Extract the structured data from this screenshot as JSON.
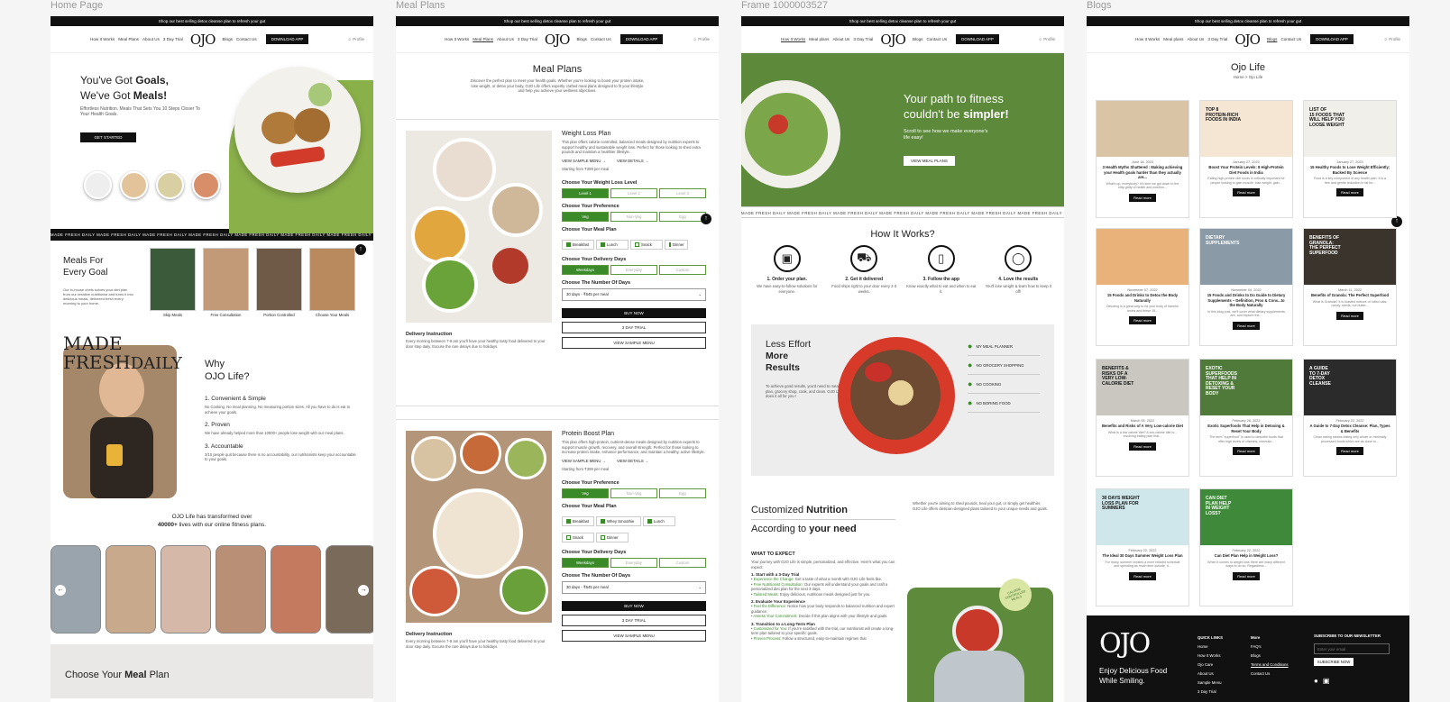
{
  "frames": {
    "home": "Home Page",
    "meal": "Meal Plans",
    "frame": "Frame 1000003527",
    "blogs": "Blogs"
  },
  "announce": "Shop our best selling detox cleanse plan to refresh your gut",
  "nav": {
    "how": "How It Works",
    "meal": "Meal Plans",
    "meal2": "Meal plans",
    "about": "About Us",
    "trial": "3 Day Trial",
    "logo": "OJO",
    "blogs": "Blogs",
    "contact": "Contact Us",
    "download": "DOWNLOAD APP",
    "profile": "Profile"
  },
  "marquee": "MADE FRESH DAILY    MADE FRESH DAILY    MADE FRESH DAILY    MADE FRESH DAILY    MADE FRESH DAILY    MADE FRESH DAILY    MADE FRESH DAILY    MADE FRESH DAILY",
  "home": {
    "hero1": "You've Got ",
    "hero1b": "Goals,",
    "hero2": "We've Got ",
    "hero2b": "Meals!",
    "sub": "Effortless Nutrition. Meals That Sets You 10 Steps Closer To Your Health Goals.",
    "cta": "GET STARTED",
    "meals_title": "Meals For Every Goal",
    "meals_desc": "Our in-house chefs solves your diet plan from our creative nutritionist and turns it into delicious meals, delivered fresh every morning to your home.",
    "tiles": [
      "Skip Meals",
      "Free Consultation",
      "Portion Controlled",
      "Choose Your Meals"
    ],
    "made": "MADE",
    "fresh": "FRESH",
    "daily": "DAILY",
    "why": "Why",
    "why2": "OJO Life?",
    "p1": "1. Convenient & Simple",
    "p1d": "No Cooking. No meal planning. No measuring portion sizes. All you have to do is eat to achieve your goals.",
    "p2": "2. Proven",
    "p2d": "We have already helped more than 10000+ people lose weight with our meal plans.",
    "p3": "3. Accountable",
    "p3d": "3/10 people quit because there is no accountability, our nutritionists keep your accountable to your goals.",
    "transform": "OJO Life has transformed over",
    "transform2": "40000+",
    "transform3": " lives with our online fitness plans.",
    "choose": "Choose Your ",
    "choose_b": "Meal",
    " choose_c": " Plan"
  },
  "meal": {
    "title": "Meal Plans",
    "intro": "Discover the perfect plan to meet your health goals. Whether you're looking to boost your protein intake, lose weight, or detox your body, OJO Life offers expertly crafted meal plans designed to fit your lifestyle and help you achieve your wellness objectives.",
    "wl": "Weight Loss Plan",
    "wl_desc": "This plan offers calorie controlled, balanced meals designed by nutrition experts to support healthy and sustainable weight loss. Perfect for those looking to shed extra pounds and maintain a healthier lifestyle.",
    "sample": "VIEW SAMPLE MENU",
    "details": "VIEW DETAILS",
    "start1": "Starting from ₹399 per meal",
    "lvl_h": "Choose Your Weight Loss Level",
    "lvls": [
      "Level 1",
      "Level 2",
      "Level 3"
    ],
    "pref_h": "Choose Your Preference",
    "prefs": [
      "Veg",
      "Non-Veg",
      "Egg"
    ],
    "mealh": "Choose Your Meal Plan",
    "meals": [
      "Breakfast",
      "Lunch",
      "Snack",
      "Dinner"
    ],
    "days_h": "Choose Your Delivery Days",
    "days": [
      "Weekdays",
      "Everyday",
      "Custom"
    ],
    "num_h": "Choose The Number Of Days",
    "num": "30 days - ₹545 per meal",
    "buy": "BUY NOW",
    "trial": "3 DAY TRIAL",
    "view": "VIEW SAMPLE MENU",
    "deliv": "Delivery Instruction",
    "deliv_d": "Every morning between 7-9 am you'll have your healthy tasty food delivered to your door step daily. Excuse the rare delays due to holidays.",
    "pb": "Protein Boost Plan",
    "pb_desc": "This plan offers high-protein, nutrient-dense meals designed by nutrition experts to support muscle growth, recovery, and overall strength. Perfect for those looking to increase protein intake, enhance performance, and maintain a healthy, active lifestyle.",
    "start2": "Starting from ₹399 per meal",
    "meals2": [
      "Breakfast",
      "Whey Smoothie",
      "Lunch",
      "Snack",
      "Dinner"
    ]
  },
  "f3": {
    "hero1": "Your path to fitness",
    "hero2": "couldn't be ",
    "hero2b": "simpler!",
    "sub": "Scroll to see how we make everyone's life easy!",
    "cta": "VIEW MEAL PLANS",
    "how": "How It Works?",
    "steps": [
      {
        "t": "1. Order your plan.",
        "d": "We have easy-to-follow solutions for everyone."
      },
      {
        "t": "2. Get it delivered",
        "d": "Food ships right to your door every 2-3 weeks."
      },
      {
        "t": "3. Follow the app",
        "d": "Know exactly what to eat and when to eat it."
      },
      {
        "t": "4. Love the results",
        "d": "You'll lose weight & learn how to keep it off!"
      }
    ],
    "less": "Less Effort",
    "more": "More",
    "results": "Results",
    "less_d": "To achieve good results, you'd need to meal plan, grocery shop, cook, and clean. OJO Life does it all for you !",
    "list": [
      "MY MEAL PLANNER",
      "NO GROCERY SHOPPING",
      "NO COOKING",
      "NO BORING FOOD"
    ],
    "cust": "Customized ",
    "cust_b": "Nutrition",
    "acc": "According to ",
    "acc_b": "your need",
    "cust_d": "Whether you're aiming to shed pounds, heal your gut, or simply get healthier, OJO Life offers dietician-designed plans tailored to your unique needs and goals.",
    "wte": "WHAT TO EXPECT",
    "wte_d": "Your journey with OJO Life is simple, personalized, and effective. Here's what you can expect:",
    "s1": "1. Start with a 3-Day Trial",
    "s1a": "Experience the Change:",
    "s1ad": " Get a taste of what a month with OJO Life feels like.",
    "s1b": "Free Nutritionist Consultation:",
    "s1bd": " Our experts will understand your goals and craft a personalized diet plan for the next 3 days.",
    "s1c": "Tailored Meals:",
    "s1cd": " Enjoy delicious, nutritious meals designed just for you.",
    "s2": "2. Evaluate Your Experience",
    "s2a": "Feel the Difference:",
    "s2ad": " Notice how your body responds to balanced nutrition and expert guidance.",
    "s2b": "Assess Your Commitment:",
    "s2bd": " Decide if this plan aligns with your lifestyle and goals.",
    "s3": "3. Transition to a Long-Term Plan",
    "s3a": "Customized for You:",
    "s3ad": " If you're satisfied with the trial, our nutritionist will create a long-term plan tailored to your specific goals.",
    "s3b": "Proven Process:",
    "s3bd": " Follow a structured, easy-to-maintain regimen that",
    "badge": "CALORIE CONTROLLED MEALS"
  },
  "blogs": {
    "title": "Ojo Life",
    "crumb": "Home  >  Ojo Life",
    "read": "Read more",
    "cards": [
      {
        "d": "June 18, 2023",
        "t": "3 Health Myths Shattered : Making achieving your Health goals harder than they actually are...",
        "e": "What's up, everybody? It's time we got down to the nitty-gritty of health and nutrition...",
        "img": "food",
        "c": "#d9c4a5"
      },
      {
        "d": "January 27, 2023",
        "t": "Boost Your Protein Levels: 8 High-Protein Diet Foods in India",
        "e": "Eating high-protein diet foods is critically important for people looking to gain muscle, lose weight, gain...",
        "img": "TOP 8\nPROTEIN-RICH\nFOODS IN INDIA",
        "c": "#f4e6d3"
      },
      {
        "d": "January 27, 2023",
        "t": "15 Healthy Foods to Lose Weight Efficiently; Backed By Science",
        "e": "Food is a key component of any health plan. It is a free and gentle reduction in fat for...",
        "img": "LIST OF\n15 FOODS THAT\nWILL HELP YOU\nLOOSE WEIGHT",
        "c": "#f1efe9"
      },
      {
        "d": "November 07, 2022",
        "t": "15 Foods and Drinks to Detox the Body Naturally",
        "e": "Detoxing is a great way to rid your body of harmful toxins and these 15...",
        "img": "mouth",
        "c": "#e8b27a"
      },
      {
        "d": "November 04, 2022",
        "t": "15 Foods and Drinks to Do Guide to Dietary Supplements – Definition, Pros & Cons...to the Body Naturally",
        "e": "In this blog post, we'll cover what dietary supplements are, and explore the...",
        "img": "DIETARY\nSUPPLEMENTS",
        "c": "#8a9aa6"
      },
      {
        "d": "March 11, 2022",
        "t": "Benefits of Granola: The Perfect Superfood",
        "e": "What is Granola? It is toasted mixture of rolled oats, honey, seeds, nut butter...",
        "img": "BENEFITS OF\nGRANOLA:\nTHE PERFECT\nSUPERFOOD",
        "c": "#3a342c"
      },
      {
        "d": "March 05, 2022",
        "t": "Benefits and Risks of A Very Low-calorie Diet",
        "e": "What is a low calorie diet? A low-calorie diet is... involving eating plan that...",
        "img": "BENEFITS &\nRISKS OF A\nVERY LOW-\nCALORIE DIET",
        "c": "#c9c7c0"
      },
      {
        "d": "February 26, 2022",
        "t": "Exotic Superfoods That Help in Detoxing & Reset Your Body",
        "e": "The term \"superfood\" is used to describe foods that offer high levels of vitamins, minerals...",
        "img": "EXOTIC\nSUPERFOODS\nTHAT HELP IN\nDETOXING &\nRESET YOUR\nBODY",
        "c": "#4f7a3a"
      },
      {
        "d": "February 22, 2022",
        "t": "A Guide to 7-Day Detox Cleanse: Plan, Types & Benefits",
        "e": "Clean eating means eating only whole or minimally processed foods which are as close to...",
        "img": "A GUIDE\nTO 7-DAY\nDETOX\nCLEANSE",
        "c": "#2b2b2b"
      },
      {
        "d": "February 22, 2022",
        "t": "The Ideal 30 Days Summer Weight Loss Plan",
        "e": "For many, summer creates a more relaxed schedule and spending as much time outside, it...",
        "img": "30 DAYS WEIGHT\nLOSS PLAN FOR\nSUMMERS",
        "c": "#cfe6ea"
      },
      {
        "d": "February 22, 2022",
        "t": "Can Diet Plan Help in Weight Loss?",
        "e": "When it comes to weight loss there are many different ways to do so. Regardless...",
        "img": "CAN DIET\nPLAN HELP\nIN WEIGHT\nLOSS?",
        "c": "#3f8a3a"
      }
    ],
    "footer": {
      "logo": "OJO",
      "tag1": "Enjoy Delicious Food",
      "tag2": "While Smiling.",
      "ql": "QUICK LINKS",
      "qlinks": [
        "Home",
        "How It Works",
        "Ojo Care",
        "About Us",
        "Sample Menu",
        "3 Day Trial"
      ],
      "more": "More",
      "mlinks": [
        "FAQ's",
        "Blogs",
        "Terms and Conditions",
        "Contact Us"
      ],
      "sub": "SUBSCRIBE TO OUR NEWSLETTER",
      "email": "Enter your email",
      "subbtn": "SUBSCRIBE NOW"
    }
  }
}
